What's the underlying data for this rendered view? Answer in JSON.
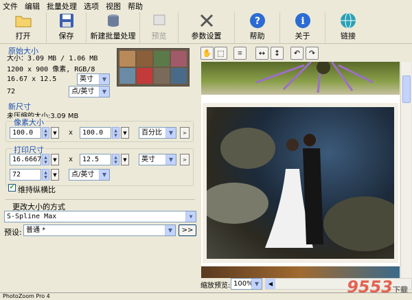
{
  "menu": [
    "文件",
    "编辑",
    "批量处理",
    "选项",
    "视图",
    "帮助"
  ],
  "toolbar": {
    "open": "打开",
    "save": "保存",
    "batch": "新建批量处理",
    "preview": "预览",
    "params": "参数设置",
    "help": "帮助",
    "about": "关于",
    "link": "链接"
  },
  "original": {
    "title": "原始大小",
    "size": "大小：3.09 MB / 1.06 MB",
    "dims": "1200 x 900 像素, RGB/8",
    "print": "16.67 x 12.5",
    "print_unit": "英寸",
    "res": "72",
    "res_unit": "点/英寸"
  },
  "newsize": {
    "title": "新尺寸",
    "uncompressed": "未压缩的大小:3.09 MB",
    "pixel_title": "像素大小",
    "width": "100.0",
    "x1": "x",
    "height": "100.0",
    "pixel_unit": "百分比",
    "print_title": "打印尺寸",
    "pwidth": "16.6667",
    "x2": "x",
    "pheight": "12.5",
    "punit": "英寸",
    "res": "72",
    "res_unit": "点/英寸",
    "keep_ratio": "维持纵横比"
  },
  "method": {
    "title": "更改大小的方式",
    "algo": "S-Spline Max",
    "preset_label": "预设:",
    "preset": "普通 *",
    "go": ">>"
  },
  "zoom": {
    "label": "缩放预览:",
    "value": "100%"
  },
  "status": "PhotoZoom Pro 4",
  "watermark": {
    "main": "9553",
    "sub": "下载"
  }
}
